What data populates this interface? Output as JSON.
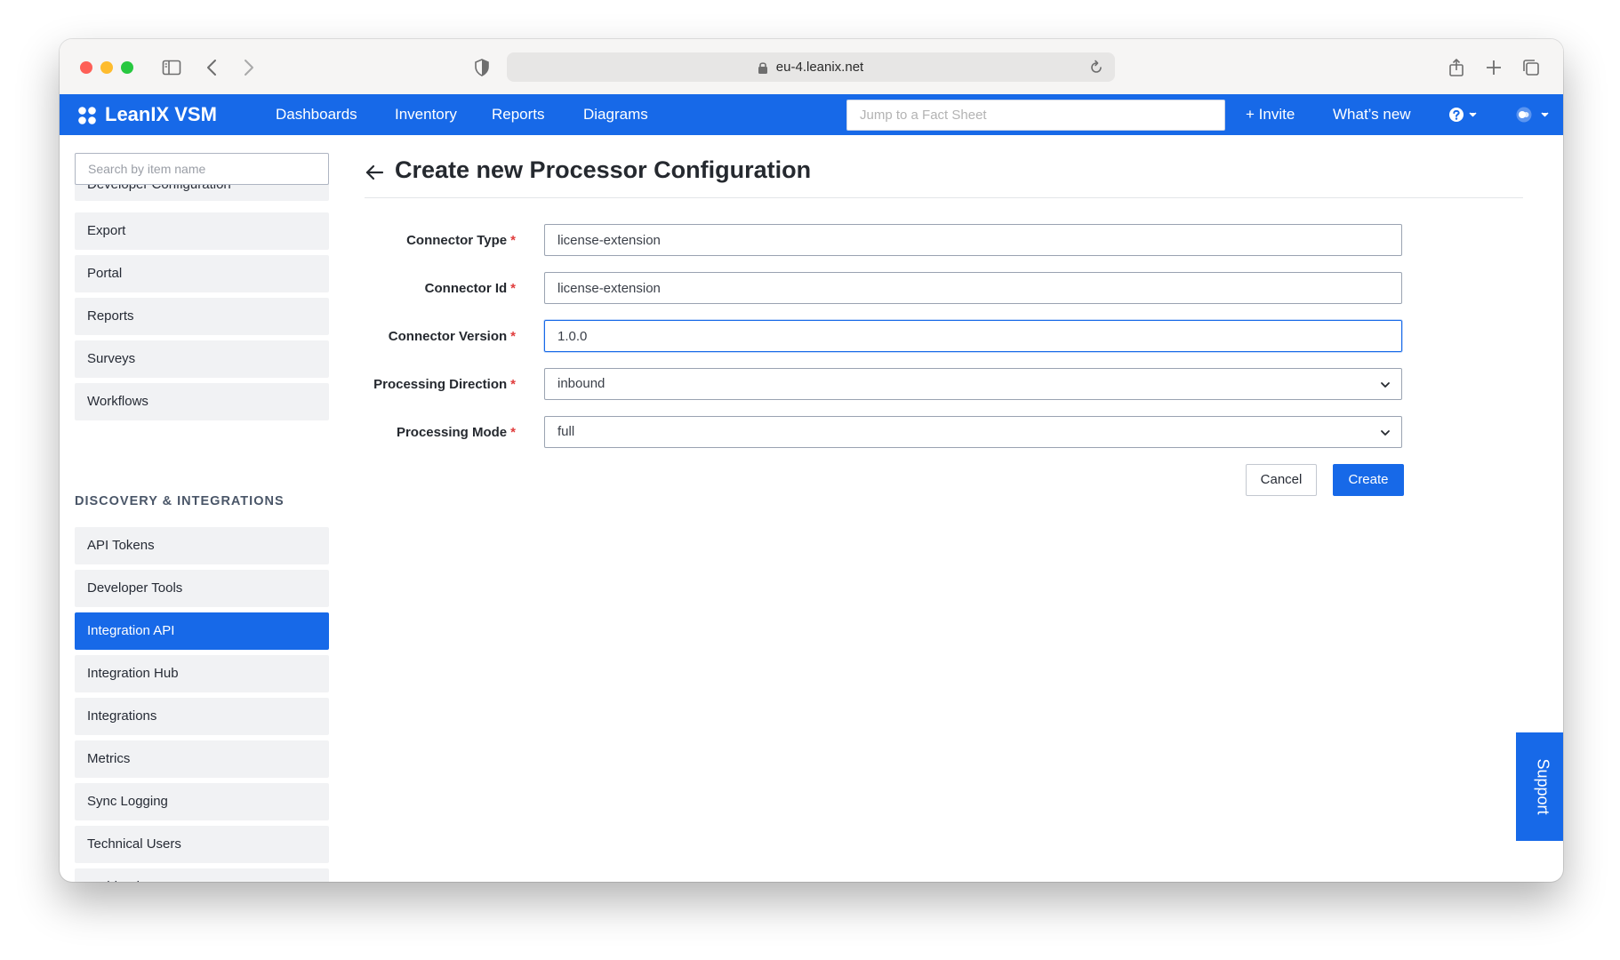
{
  "browser": {
    "address": "eu-4.leanix.net"
  },
  "navbar": {
    "brand": "LeanIX VSM",
    "items": [
      "Dashboards",
      "Inventory",
      "Reports",
      "Diagrams"
    ],
    "search_placeholder": "Jump to a Fact Sheet",
    "invite": "+ Invite",
    "whats_new": "What’s new",
    "accent": "#1769e8"
  },
  "sidebar": {
    "search_placeholder": "Search by item name",
    "items_top": [
      "Developer Configuration",
      "Export",
      "Portal",
      "Reports",
      "Surveys",
      "Workflows"
    ],
    "section_heading": "DISCOVERY & INTEGRATIONS",
    "items_section": [
      "API Tokens",
      "Developer Tools",
      "Integration API",
      "Integration Hub",
      "Integrations",
      "Metrics",
      "Sync Logging",
      "Technical Users",
      "Webhooks"
    ],
    "active_item": "Integration API"
  },
  "main": {
    "title": "Create new Processor Configuration",
    "fields": [
      {
        "label": "Connector Type",
        "value": "license-extension",
        "type": "text"
      },
      {
        "label": "Connector Id",
        "value": "license-extension",
        "type": "text"
      },
      {
        "label": "Connector Version",
        "value": "1.0.0",
        "type": "text"
      },
      {
        "label": "Processing Direction",
        "value": "inbound",
        "type": "select"
      },
      {
        "label": "Processing Mode",
        "value": "full",
        "type": "select"
      }
    ],
    "required_marker": "*",
    "cancel_label": "Cancel",
    "create_label": "Create"
  },
  "support_label": "Support"
}
